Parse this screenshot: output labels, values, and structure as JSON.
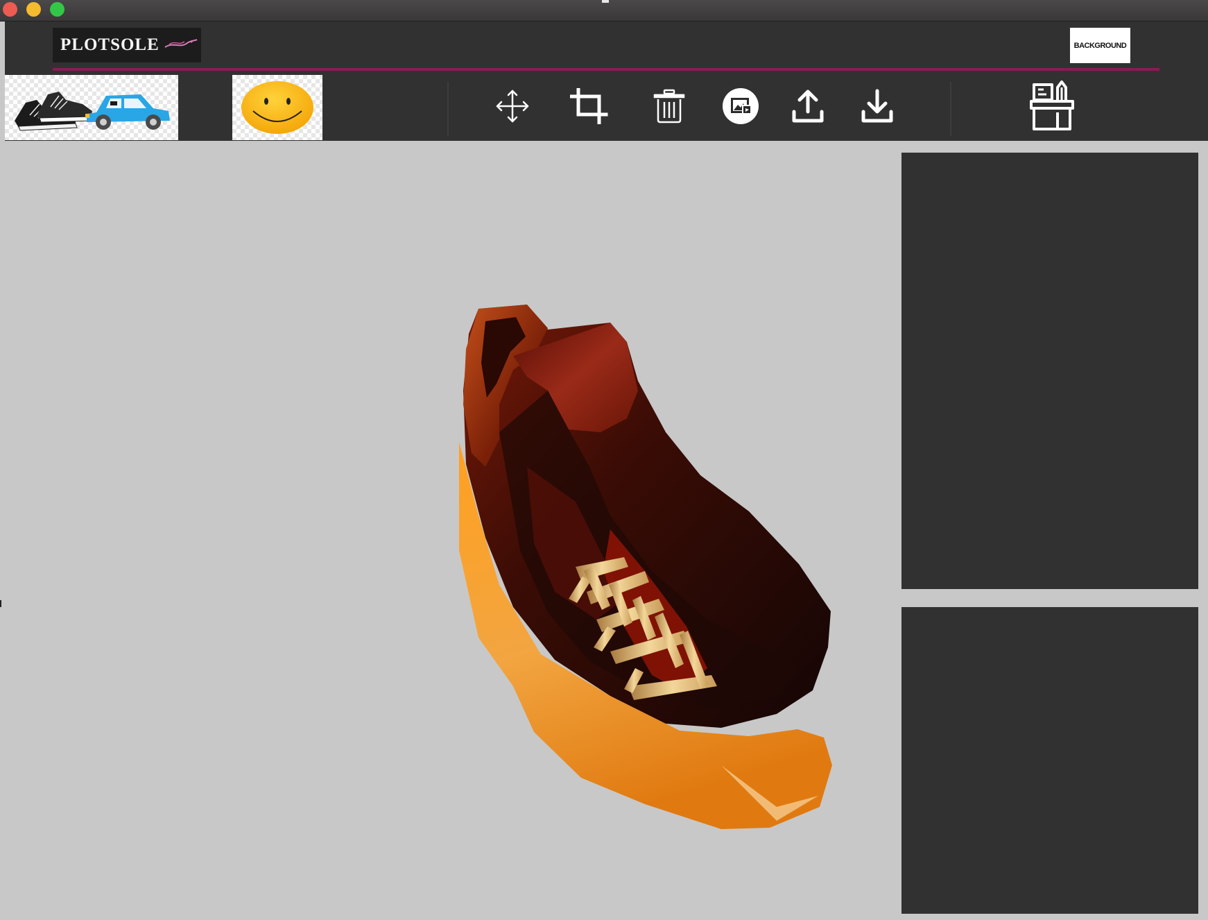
{
  "app": {
    "logo_text": "PLOTSOLE",
    "background_button_label": "BACKGROUND"
  },
  "thumbnails": [
    {
      "name": "shoes-and-car-sticker"
    },
    {
      "name": "smiley-sticker"
    }
  ],
  "toolbar": {
    "tools": [
      "move",
      "crop",
      "delete",
      "image",
      "upload",
      "download",
      "workspace"
    ]
  },
  "colors": {
    "accent": "#8a1b57",
    "panel": "#313131",
    "viewport": "#c8c8c8"
  },
  "icons": [
    "move-icon",
    "crop-icon",
    "trash-icon",
    "image-icon",
    "upload-icon",
    "download-icon",
    "desk-icon"
  ]
}
